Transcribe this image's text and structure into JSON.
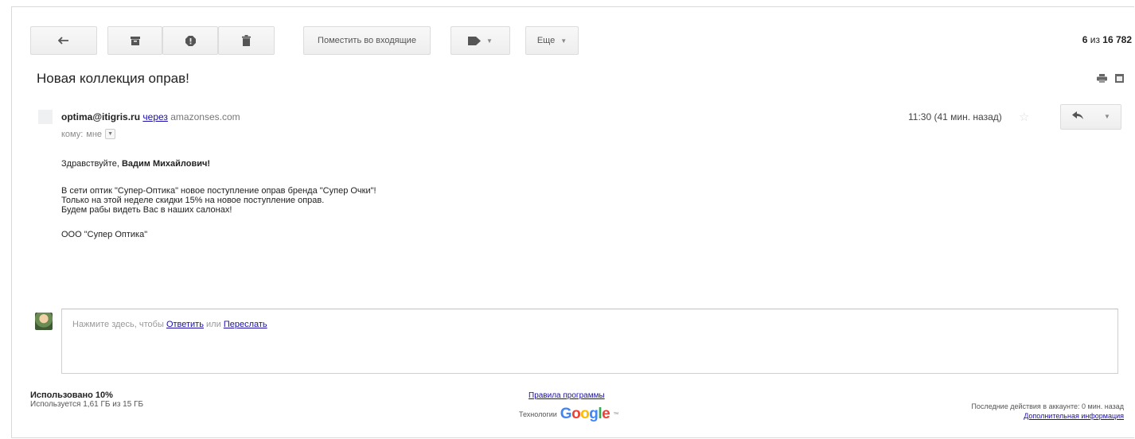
{
  "colors": {
    "link": "#1a0dab",
    "button_bg": "#f2f2f2",
    "border": "#dcdcdc"
  },
  "toolbar": {
    "back_icon": "back-arrow-icon",
    "archive_icon": "archive-icon",
    "spam_icon": "report-spam-icon",
    "delete_icon": "trash-icon",
    "move_inbox_label": "Поместить во входящие",
    "labels_icon": "label-tag-icon",
    "more_label": "Еще"
  },
  "counter": {
    "position": "6",
    "of": "из",
    "total": "16 782"
  },
  "message": {
    "subject": "Новая коллекция оправ!",
    "sender_email": "optima@itigris.ru",
    "via_label": "через",
    "via_domain": "amazonses.com",
    "to_label": "кому:",
    "to_value": "мне",
    "timestamp": "11:30 (41 мин. назад)",
    "body": {
      "greeting": "Здравствуйте,",
      "greeting_name": "Вадим Михайлович!",
      "line1": "В сети оптик \"Супер-Оптика\" новое поступление оправ бренда \"Супер Очки\"!",
      "line2": "Только на этой неделе скидки 15% на новое поступление оправ.",
      "line3": "Будем рабы видеть Вас в наших салонах!",
      "signature": "ООО \"Супер Оптика\""
    }
  },
  "reply_box": {
    "prefix": "Нажмите здесь, чтобы",
    "reply_link": "Ответить",
    "or_text": "или",
    "forward_link": "Переслать"
  },
  "footer": {
    "quota_title": "Использовано 10%",
    "quota_detail": "Используется 1,61 ГБ из 15 ГБ",
    "terms_link": "Правила программы",
    "powered_by": "Технологии",
    "activity_text": "Последние действия в аккаунте: 0 мин. назад",
    "details_link": "Дополнительная информация"
  }
}
